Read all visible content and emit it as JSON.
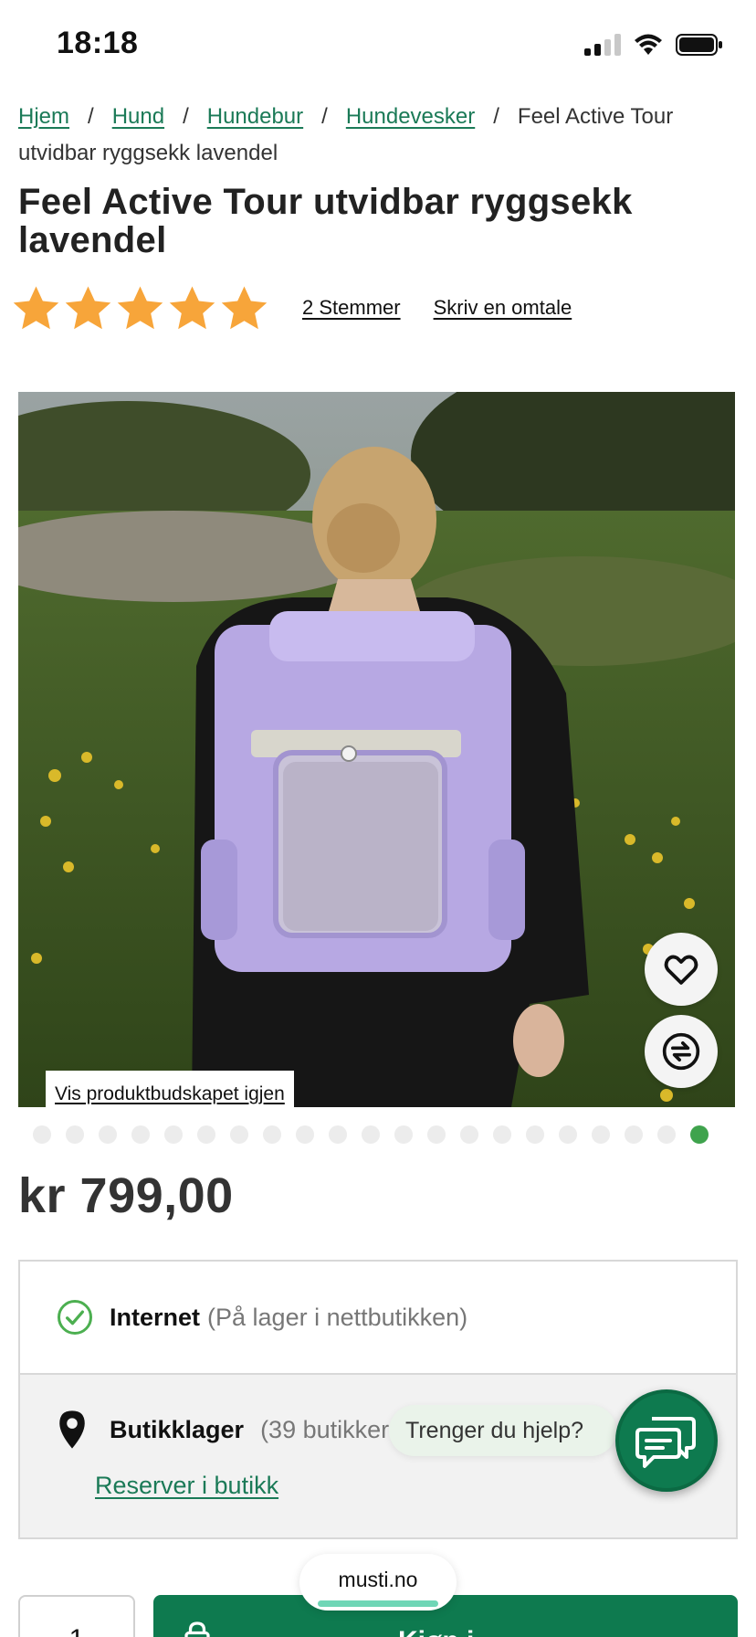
{
  "status_bar": {
    "time": "18:18"
  },
  "breadcrumb": {
    "items": [
      "Hjem",
      "Hund",
      "Hundebur",
      "Hundevesker"
    ],
    "separator": "/",
    "current": "Feel Active Tour utvidbar ryggsekk lavendel"
  },
  "product": {
    "title": "Feel Active Tour utvidbar ryggsekk lavendel",
    "rating": {
      "stars": 5,
      "max": 5,
      "votes_label": "2 Stemmer",
      "review_label": "Skriv en omtale"
    },
    "image": {
      "relaunch_label": "Vis produktbudskapet igjen",
      "slide_count": 21,
      "active_slide": 21
    },
    "price": "kr 799,00"
  },
  "stock": {
    "online_title": "Internet",
    "online_note": "(På lager i nettbutikken)",
    "store_title": "Butikklager",
    "store_note": "(39 butikker",
    "reserve_label": "Reserver i butikk"
  },
  "chat": {
    "bubble_text": "Trenger du hjelp?"
  },
  "purchase": {
    "quantity": "1",
    "buy_label": "Kjøp i"
  },
  "browser": {
    "url": "musti.no"
  },
  "colors": {
    "accent": "#0e7a4f",
    "link": "#1b7a57",
    "star": "#f7a53a",
    "dot_active": "#3fa34d"
  }
}
